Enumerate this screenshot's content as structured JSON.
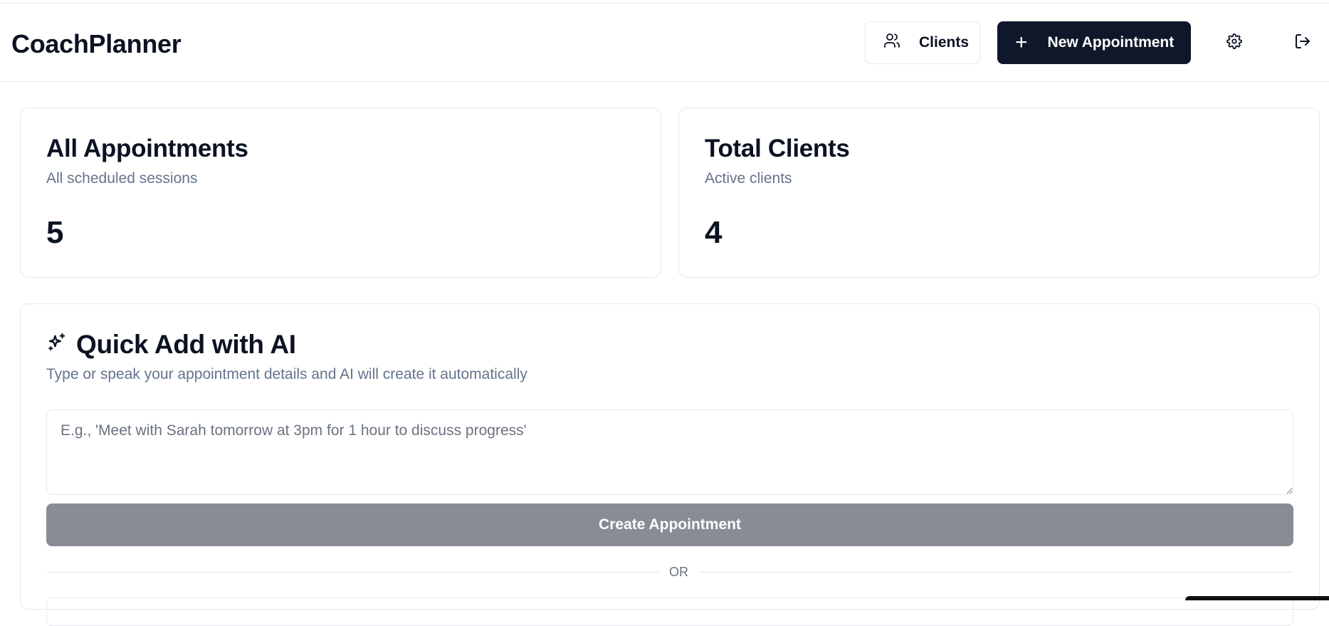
{
  "app": {
    "title": "CoachPlanner"
  },
  "header": {
    "clients_label": "Clients",
    "new_appointment_label": "New Appointment",
    "icons": {
      "clients": "users-icon",
      "new": "plus-icon",
      "settings": "gear-icon",
      "logout": "logout-icon"
    }
  },
  "stats": [
    {
      "title": "All Appointments",
      "subtitle": "All scheduled sessions",
      "value": "5"
    },
    {
      "title": "Total Clients",
      "subtitle": "Active clients",
      "value": "4"
    }
  ],
  "quick_add": {
    "title": "Quick Add with AI",
    "icon": "sparkles-icon",
    "subtitle": "Type or speak your appointment details and AI will create it automatically",
    "placeholder": "E.g., 'Meet with Sarah tomorrow at 3pm for 1 hour to discuss progress'",
    "value": "",
    "button_label": "Create Appointment",
    "divider_label": "OR"
  },
  "colors": {
    "primary": "#0f172a",
    "disabled_button": "#888c94",
    "muted_text": "#64748b",
    "border": "#e5e7eb"
  }
}
